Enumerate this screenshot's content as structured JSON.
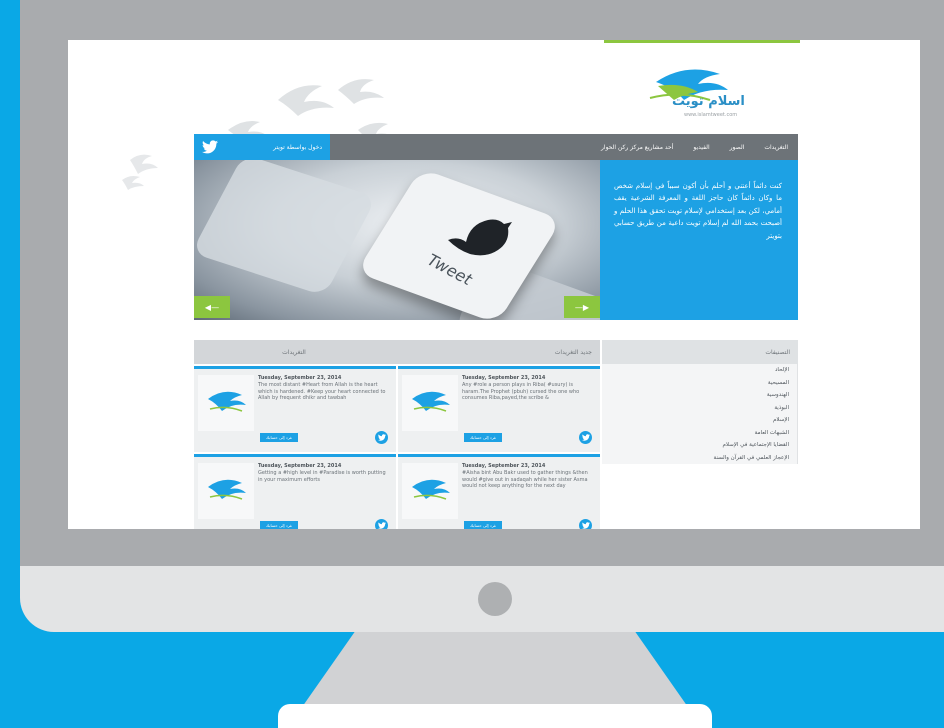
{
  "site": {
    "logo_text": "اسلام تويت",
    "logo_subtext": "www.islamtweet.com",
    "accent_colors": {
      "primary": "#1da1e4",
      "green": "#8cc63f",
      "nav": "#6d7378"
    }
  },
  "navbar": {
    "twitter_login_label": "دخول بواسطة تويتر",
    "items": [
      {
        "label": "التغريدات"
      },
      {
        "label": "الصور"
      },
      {
        "label": "الفيديو"
      },
      {
        "label": "أحد مشاريع مركز ركن الحوار"
      }
    ]
  },
  "hero": {
    "image_word": "Tweet",
    "text": "كنت دائماً أعتني و أحلم بأن أكون سبباً في إسلام شخص ما وكان دائماً كان حاجز اللغة و المعرفة الشرعية يقف أمامي، لكن بعد إستخدامي لإسلام تويت تحقق هذا الحلم و أصبحت بحمد الله لم إسلام تويت داعية من طريق حسابي بتويتر",
    "prev_icon": "arrow-left-icon",
    "next_icon": "arrow-right-icon"
  },
  "columns": {
    "latest_header": "التغريدات",
    "featured_header": "جديد التغريدات",
    "categories_header": "التصنيفات"
  },
  "tweets": [
    {
      "date": "Tuesday, September 23, 2014",
      "body": "The most distant #Heart from Allah is the heart which is hardened. #Keep your heart connected to Allah by frequent dhikr and tawbah",
      "more_label": "غرد إلى حسابك"
    },
    {
      "date": "Tuesday, September 23, 2014",
      "body": "Any #role a person plays in Riba( #usury) is haram.The Prophet (pbuh) cursed the one who consumes Riba,payed,the scribe &",
      "more_label": "غرد إلى حسابك"
    },
    {
      "date": "Tuesday, September 23, 2014",
      "body": "Getting a #high level in #Paradise is worth putting in your maximum efforts",
      "more_label": "غرد إلى حسابك"
    },
    {
      "date": "Tuesday, September 23, 2014",
      "body": "#Aisha bint Abu Bakr used to gather things &then would #give out in sadaqah while her sister Asma would not keep anything for the next day",
      "more_label": "غرد إلى حسابك"
    }
  ],
  "categories": [
    "الإلحاد",
    "المسيحية",
    "الهندوسية",
    "البوذية",
    "الإسلام",
    "الشبهات العامة",
    "القضايا الإجتماعية في الإسلام",
    "الإعجاز العلمي في القرآن والسنة"
  ]
}
